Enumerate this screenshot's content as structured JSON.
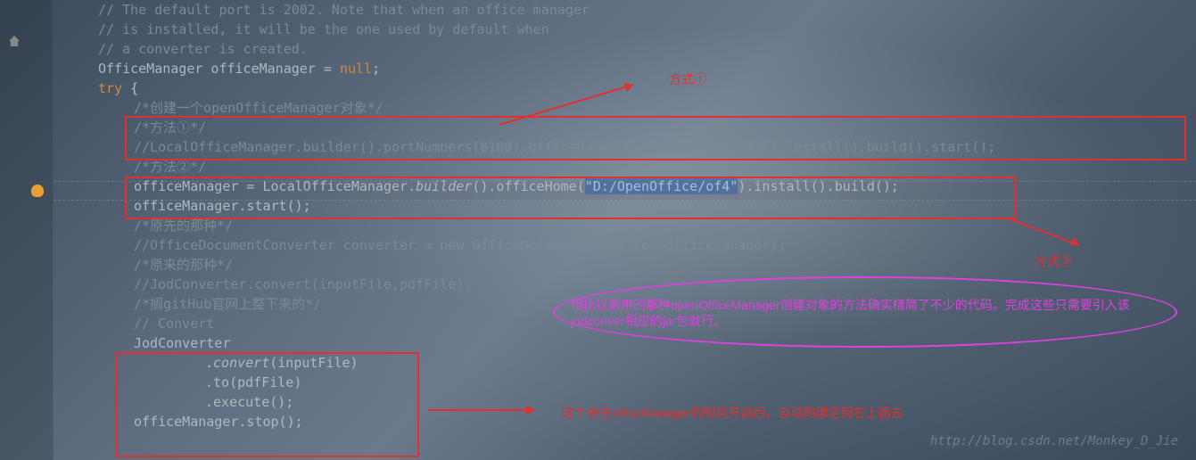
{
  "code": {
    "l1": "// The default port is 2002. Note that when an office manager",
    "l2": "// is installed, it will be the one used by default when",
    "l3": "// a converter is created.",
    "l4_type": "OfficeManager",
    "l4_var": " officeManager = ",
    "l4_null": "null",
    "l4_end": ";",
    "l5_try": "try",
    "l5_brace": " {",
    "l6": "/*创建一个openOfficeManager对象*/",
    "l7": "/*方法①*/",
    "l8": "//LocalOfficeManager.builder().portNumbers(8100).officeHome(\"D:/OpenOffice/of4\").install().build().start();",
    "l9": "/*方法②*/",
    "l10a": "officeManager = LocalOfficeManager.",
    "l10b": "builder",
    "l10c": "().officeHome(",
    "l10d": "\"D:/OpenOffice/of4\"",
    "l10e": ").install().build();",
    "l11": "officeManager.start();",
    "l12": "/*原先的那种*/",
    "l13": "//OfficeDocumentConverter converter = new OfficeDocumentConverter(officeManager);",
    "l14": "/*原来的那种*/",
    "l15": "//JodConverter.convert(inputFile,pdfFile);",
    "l16": "/*搁gitHub官网上整下来的*/",
    "l17": "// Convert",
    "l18": "JodConverter",
    "l19a": ".",
    "l19b": "convert",
    "l19c": "(inputFile)",
    "l20": ".to(pdfFile)",
    "l21": ".execute();",
    "l22": "officeManager.stop();"
  },
  "annotations": {
    "method1_label": "方式①",
    "method2_label": "方式②",
    "ellipse_text": "相比以前用的那种openOfficeManager创建对象的方法确实精简了不少的代码。完成这些只需要引入该jodconver相应的jar包就行。",
    "bottom_label": "这个会在officeManager的服务开启后，自动的绑定到它上面去"
  },
  "watermark": "http://blog.csdn.net/Monkey_D_Jie",
  "colors": {
    "annotation_red": "#e03030",
    "annotation_magenta": "#e040e0",
    "keyword": "#cc8a3a",
    "comment": "#7a8a95"
  }
}
